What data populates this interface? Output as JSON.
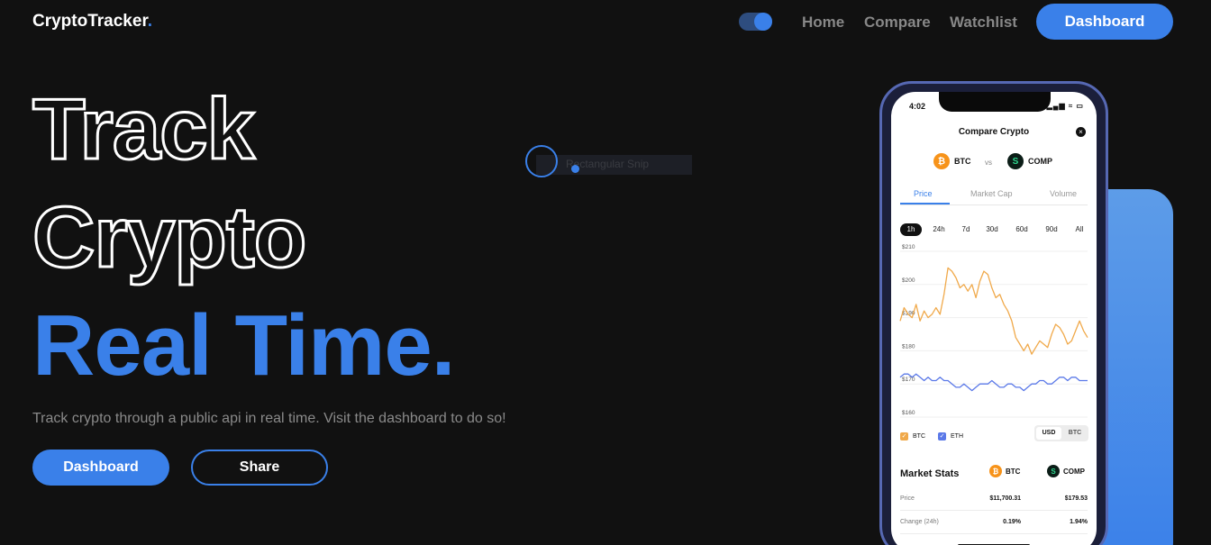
{
  "header": {
    "logo_text": "CryptoTracker",
    "logo_dot": ".",
    "nav": {
      "home": "Home",
      "compare": "Compare",
      "watchlist": "Watchlist",
      "dashboard": "Dashboard"
    },
    "theme_toggle_on": true
  },
  "hero": {
    "line1": "Track",
    "line2": "Crypto",
    "line3": "Real Time.",
    "tagline": "Track crypto through a public api in real time. Visit the dashboard to do so!",
    "primary_button": "Dashboard",
    "secondary_button": "Share"
  },
  "snip": {
    "label": "Rectangular Snip"
  },
  "phone": {
    "time": "4:02",
    "status_icons": "▂▄▆ ≈ ▭",
    "title": "Compare Crypto",
    "close": "×",
    "coin1": {
      "symbol": "BTC",
      "icon": "₿"
    },
    "vs": "vs",
    "coin2": {
      "symbol": "COMP",
      "icon": "S"
    },
    "tabs": [
      "Price",
      "Market Cap",
      "Volume"
    ],
    "ranges": [
      "1h",
      "24h",
      "7d",
      "30d",
      "60d",
      "90d",
      "All"
    ],
    "legend": {
      "btc": "BTC",
      "eth": "ETH",
      "check": "✓"
    },
    "currency": {
      "usd": "USD",
      "btc": "BTC"
    },
    "stats": {
      "title": "Market Stats",
      "coin1": "BTC",
      "coin2": "COMP",
      "rows": [
        {
          "label": "Price",
          "v1": "$11,700.31",
          "v2": "$179.53"
        },
        {
          "label": "Change (24h)",
          "v1": "0.19%",
          "v2": "1.94%"
        }
      ]
    }
  },
  "colors": {
    "accent": "#3a80e9",
    "background": "#111111",
    "btc_line": "#f0a94a",
    "eth_line": "#5b79e8"
  },
  "chart_data": {
    "type": "line",
    "yticks": [
      "$210",
      "$200",
      "$190",
      "$180",
      "$170",
      "$160"
    ],
    "ylim": [
      160,
      210
    ],
    "series": [
      {
        "name": "BTC",
        "values": [
          189,
          193,
          191,
          190,
          194,
          189,
          192,
          190,
          191,
          193,
          191,
          197,
          205,
          204,
          202,
          199,
          200,
          198,
          200,
          196,
          201,
          204,
          203,
          199,
          196,
          197,
          194,
          192,
          189,
          184,
          182,
          180,
          182,
          179,
          181,
          183,
          182,
          181,
          185,
          188,
          187,
          185,
          182,
          183,
          186,
          189,
          186,
          184
        ]
      },
      {
        "name": "ETH",
        "values": [
          172,
          173,
          173,
          172,
          173,
          172,
          171,
          172,
          171,
          171,
          172,
          171,
          171,
          170,
          169,
          169,
          170,
          169,
          168,
          169,
          170,
          170,
          170,
          171,
          170,
          169,
          169,
          170,
          170,
          169,
          169,
          168,
          169,
          170,
          170,
          171,
          171,
          170,
          170,
          171,
          172,
          172,
          171,
          172,
          172,
          171,
          171,
          171
        ]
      }
    ]
  }
}
